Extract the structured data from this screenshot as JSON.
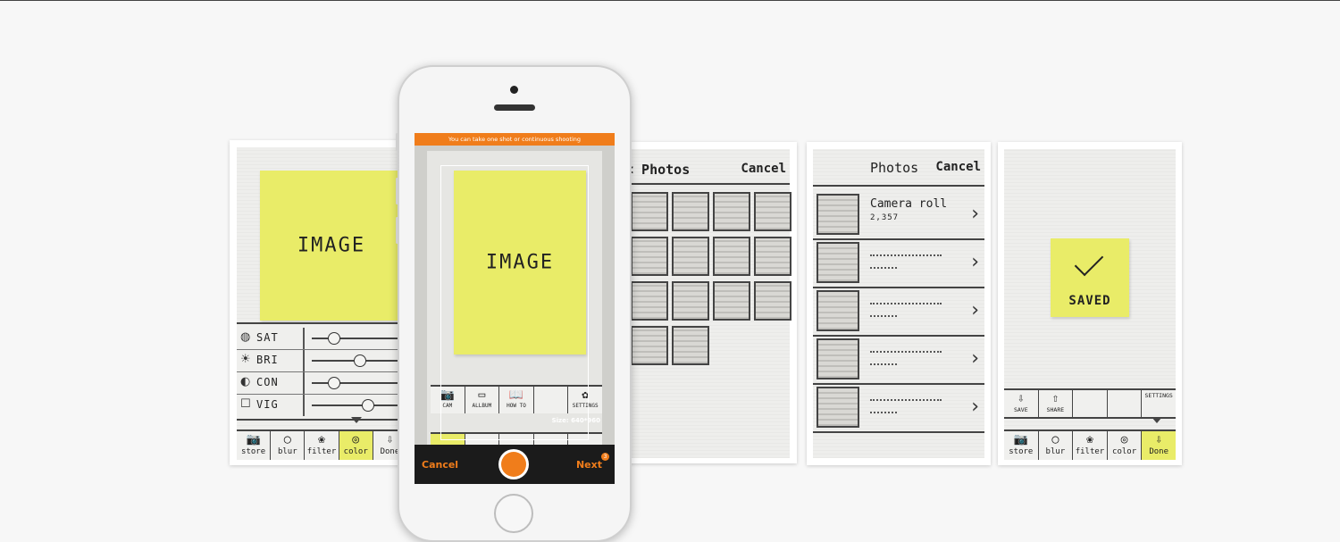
{
  "screen1": {
    "image_label": "IMAGE",
    "sliders": [
      {
        "icon_name": "saturation-icon",
        "icon": "◍",
        "label": "SAT",
        "level": 0.25
      },
      {
        "icon_name": "brightness-icon",
        "icon": "☀",
        "label": "BRI",
        "level": 0.55
      },
      {
        "icon_name": "contrast-icon",
        "icon": "◐",
        "label": "CON",
        "level": 0.25
      },
      {
        "icon_name": "vignette-icon",
        "icon": "☐",
        "label": "VIG",
        "level": 0.65
      }
    ],
    "toolbar": [
      {
        "icon_name": "camera-icon",
        "icon": "📷",
        "label": "store"
      },
      {
        "icon_name": "blur-icon",
        "icon": "◯",
        "label": "blur"
      },
      {
        "icon_name": "filter-icon",
        "icon": "❀",
        "label": "filter"
      },
      {
        "icon_name": "color-icon",
        "icon": "◎",
        "label": "color",
        "selected": true
      },
      {
        "icon_name": "done-icon",
        "icon": "⇩",
        "label": "Done"
      }
    ]
  },
  "phone": {
    "banner": "You can take one shot or continuous shooting",
    "image_label": "IMAGE",
    "size_text": "Size: 640*960",
    "cancel_label": "Cancel",
    "next_label": "Next",
    "next_badge": "3",
    "inner_toolbar": [
      {
        "icon_name": "cam-icon",
        "icon": "📷",
        "label": "CAM"
      },
      {
        "icon_name": "album-icon",
        "icon": "▭",
        "label": "ALLBUM"
      },
      {
        "icon_name": "howto-icon",
        "icon": "📖",
        "label": "HOW TO"
      },
      {
        "icon_name": "blank-icon",
        "icon": "",
        "label": ""
      },
      {
        "icon_name": "settings-icon",
        "icon": "✿",
        "label": "SETTINGS"
      }
    ],
    "accent": "#f07d1b"
  },
  "screen3": {
    "back_label": "< Photos",
    "cancel_label": "Cancel",
    "grid": {
      "rows": 4,
      "cols": 4,
      "filled": 14
    }
  },
  "screen4": {
    "title": "Photos",
    "cancel_label": "Cancel",
    "rows": [
      {
        "title": "Camera roll",
        "subtitle": "2,357"
      },
      {
        "title": "",
        "subtitle": ""
      },
      {
        "title": "",
        "subtitle": ""
      },
      {
        "title": "",
        "subtitle": ""
      },
      {
        "title": "",
        "subtitle": ""
      }
    ]
  },
  "screen5": {
    "saved_label": "SAVED",
    "top_toolbar": [
      {
        "icon_name": "save-icon",
        "icon": "⇩",
        "label": "SAVE"
      },
      {
        "icon_name": "share-icon",
        "icon": "⇧",
        "label": "SHARE"
      },
      {
        "icon_name": "blank-icon",
        "icon": "",
        "label": ""
      },
      {
        "icon_name": "blank-icon",
        "icon": "",
        "label": ""
      },
      {
        "icon_name": "settings-icon",
        "icon": "",
        "label": "SETTINGS"
      }
    ],
    "toolbar": [
      {
        "icon_name": "camera-icon",
        "icon": "📷",
        "label": "store"
      },
      {
        "icon_name": "blur-icon",
        "icon": "◯",
        "label": "blur"
      },
      {
        "icon_name": "filter-icon",
        "icon": "❀",
        "label": "filter"
      },
      {
        "icon_name": "color-icon",
        "icon": "◎",
        "label": "color"
      },
      {
        "icon_name": "done-icon",
        "icon": "⇩",
        "label": "Done",
        "selected": true
      }
    ]
  }
}
